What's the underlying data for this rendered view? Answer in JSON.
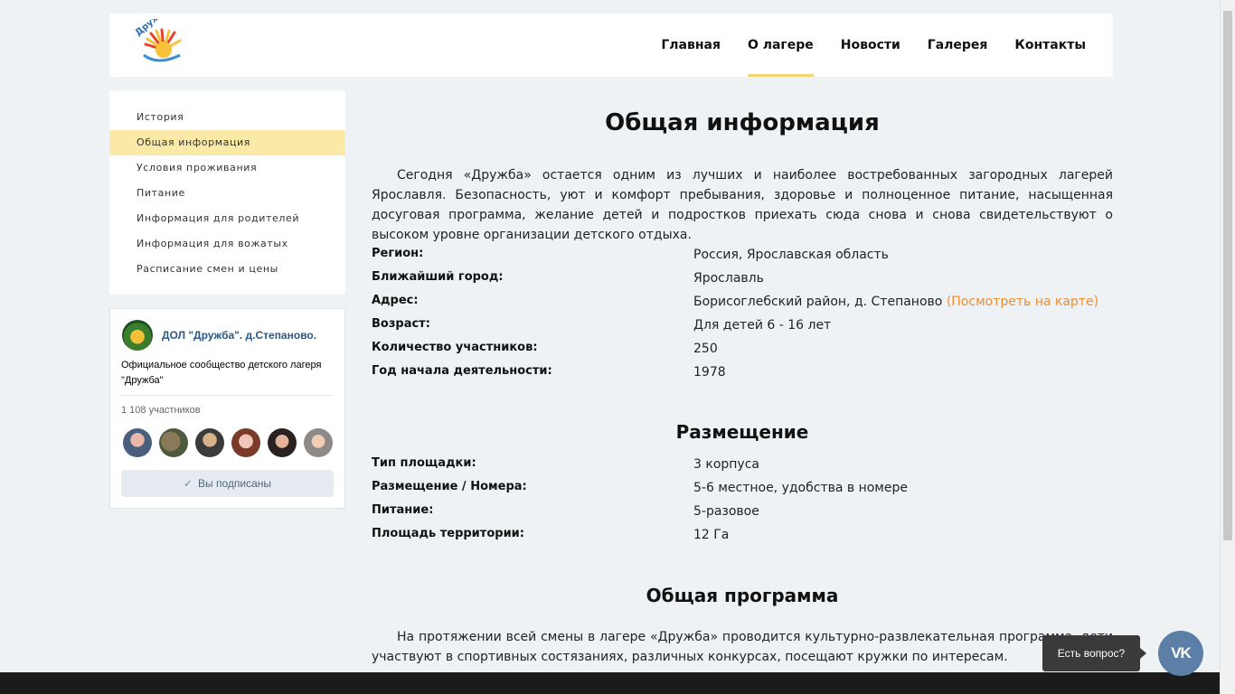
{
  "header": {
    "logo_text": "Дружба",
    "nav": [
      {
        "label": "Главная"
      },
      {
        "label": "О лагере"
      },
      {
        "label": "Новости"
      },
      {
        "label": "Галерея"
      },
      {
        "label": "Контакты"
      }
    ],
    "active_nav": "О лагере"
  },
  "sidebar": {
    "items": [
      {
        "label": "История"
      },
      {
        "label": "Общая информация"
      },
      {
        "label": "Условия проживания"
      },
      {
        "label": "Питание"
      },
      {
        "label": "Информация для родителей"
      },
      {
        "label": "Информация для вожатых"
      },
      {
        "label": "Расписание смен и цены"
      }
    ],
    "active_item": "Общая информация"
  },
  "vk_widget": {
    "group_name": "ДОЛ \"Дружба\". д.Степаново.",
    "description": "Официальное сообщество детского лагеря \"Дружба\"",
    "members": "1 108 участников",
    "subscribed_label": "Вы подписаны"
  },
  "main": {
    "title": "Общая информация",
    "intro": "Сегодня «Дружба» остается одним из лучших и наиболее востребованных загородных лагерей Ярославля. Безопасность, уют и комфорт пребывания, здоровье и полноценное питание, насыщенная досуговая программа, желание детей и подростков приехать сюда снова и снова свидетельствуют о высоком уровне организации детского отдыха.",
    "info": [
      {
        "label": "Регион:",
        "value": "Россия, Ярославская область"
      },
      {
        "label": "Ближайший город:",
        "value": "Ярославль"
      },
      {
        "label": "Адрес:",
        "value": "Борисоглебский район, д. Степаново",
        "link": "(Посмотреть на карте)"
      },
      {
        "label": "Возраст:",
        "value": "Для детей 6 - 16 лет"
      },
      {
        "label": "Количество участников:",
        "value": "250"
      },
      {
        "label": "Год начала деятельности:",
        "value": "1978"
      }
    ],
    "placement_title": "Размещение",
    "placement": [
      {
        "label": "Тип площадки:",
        "value": "3 корпуса"
      },
      {
        "label": "Размещение / Номера:",
        "value": "5-6 местное, удобства в номере"
      },
      {
        "label": "Питание:",
        "value": "5-разовое"
      },
      {
        "label": "Площадь территории:",
        "value": "12 Га"
      }
    ],
    "program_title": "Общая программа",
    "program_text": "На протяжении всей смены в лагере «Дружба» проводится культурно-развлекательная программа, дети участвуют в спортивных состязаниях, различных конкурсах, посещают кружки по интересам."
  },
  "widgets": {
    "ask_label": "Есть вопрос?",
    "vk_label": "VK"
  },
  "colors": {
    "accent": "#f4d570",
    "sidebar_active": "#fbeaa7",
    "link": "#ef8d2b",
    "vk_blue": "#2a5885"
  }
}
